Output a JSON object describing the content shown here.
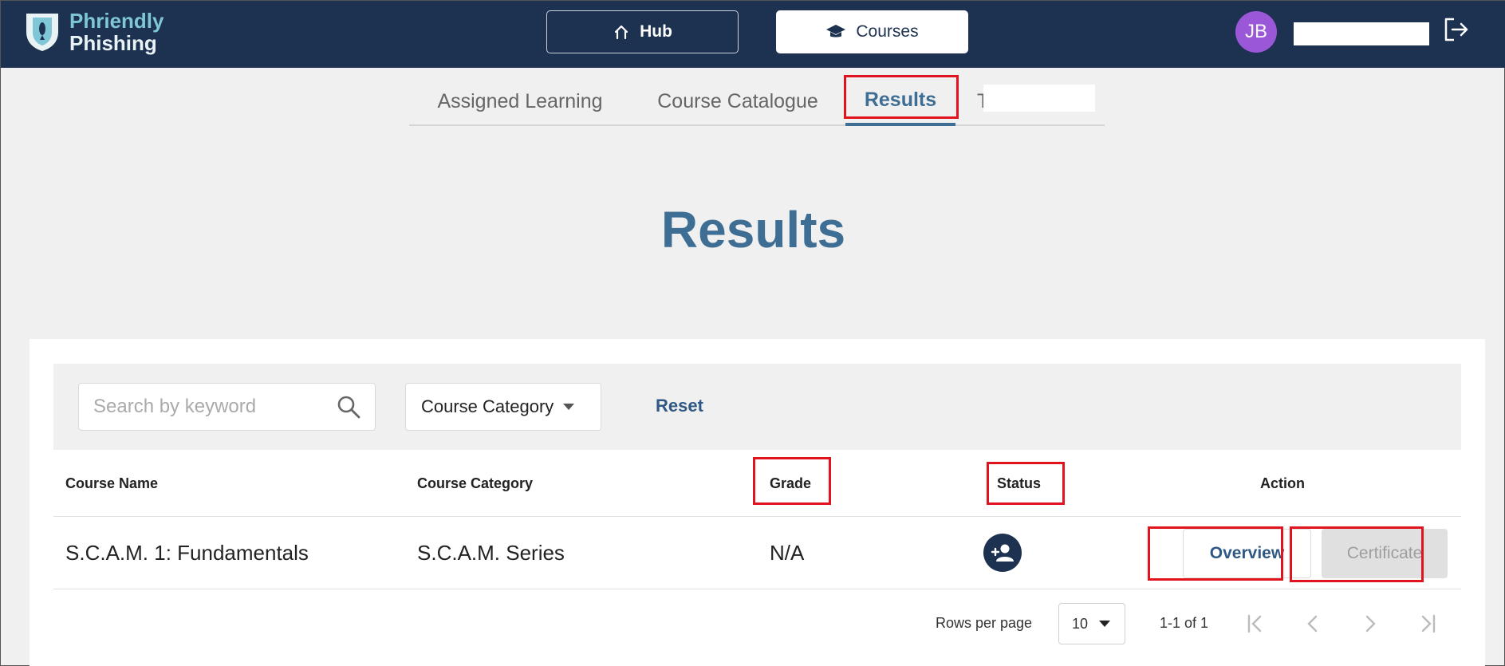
{
  "brand": {
    "line1": "Phriendly",
    "line2": "Phishing"
  },
  "topnav": {
    "hub_label": "Hub",
    "courses_label": "Courses",
    "avatar_initials": "JB"
  },
  "tabs": [
    {
      "label": "Assigned Learning"
    },
    {
      "label": "Course Catalogue"
    },
    {
      "label": "Results",
      "active": true
    },
    {
      "label": "T"
    }
  ],
  "page": {
    "title": "Results"
  },
  "filters": {
    "search_placeholder": "Search by keyword",
    "category_label": "Course Category",
    "reset_label": "Reset"
  },
  "table": {
    "columns": [
      "Course Name",
      "Course Category",
      "Grade",
      "Status",
      "Action"
    ],
    "rows": [
      {
        "course_name": "S.C.A.M. 1: Fundamentals",
        "course_category": "S.C.A.M. Series",
        "grade": "N/A",
        "status_icon": "person-add-icon",
        "actions": {
          "overview": "Overview",
          "certificate": "Certificate"
        }
      }
    ]
  },
  "pagination": {
    "rows_per_page_label": "Rows per page",
    "rows_per_page_value": "10",
    "range": "1-1 of 1"
  },
  "colors": {
    "topbar": "#1d3150",
    "accent": "#3f6e95",
    "avatar": "#9a57d8",
    "highlight": "#e0141e"
  }
}
